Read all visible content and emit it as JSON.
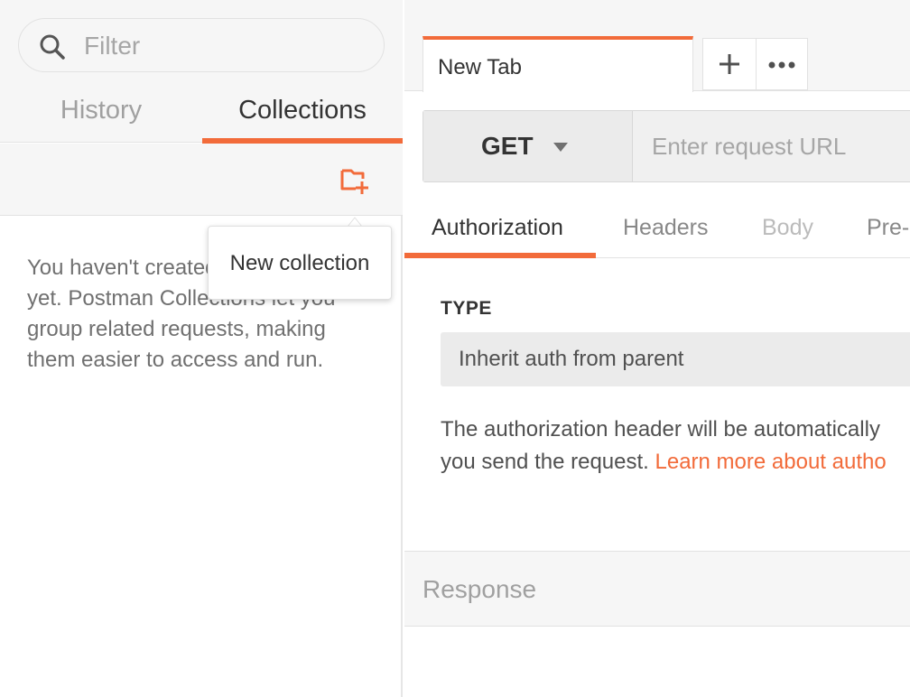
{
  "sidebar": {
    "filter_placeholder": "Filter",
    "tabs": [
      {
        "label": "History",
        "active": false
      },
      {
        "label": "Collections",
        "active": true
      }
    ],
    "new_collection_icon": "folder-plus-icon",
    "empty_message": "You haven't created any collections yet. Postman Collections let you group related requests, making them easier to access and run.",
    "tooltip": "New collection"
  },
  "main": {
    "tabs": [
      {
        "label": "New Tab",
        "active": true
      }
    ],
    "add_tab_icon": "plus-icon",
    "more_icon": "ellipsis-icon",
    "method": "GET",
    "url_placeholder": "Enter request URL",
    "sub_tabs": [
      {
        "label": "Authorization",
        "active": true
      },
      {
        "label": "Headers",
        "active": false
      },
      {
        "label": "Body",
        "active": false,
        "disabled": true
      },
      {
        "label": "Pre-",
        "active": false
      }
    ],
    "auth": {
      "type_label": "TYPE",
      "type_value": "Inherit auth from parent",
      "description_line1": "The authorization header will be automatically",
      "description_line2": "you send the request. ",
      "learn_more": "Learn more about autho"
    },
    "response_label": "Response"
  },
  "colors": {
    "accent": "#f26b3a",
    "panel_bg": "#f6f6f6",
    "text_dark": "#333333",
    "text_muted": "#a0a0a0"
  }
}
